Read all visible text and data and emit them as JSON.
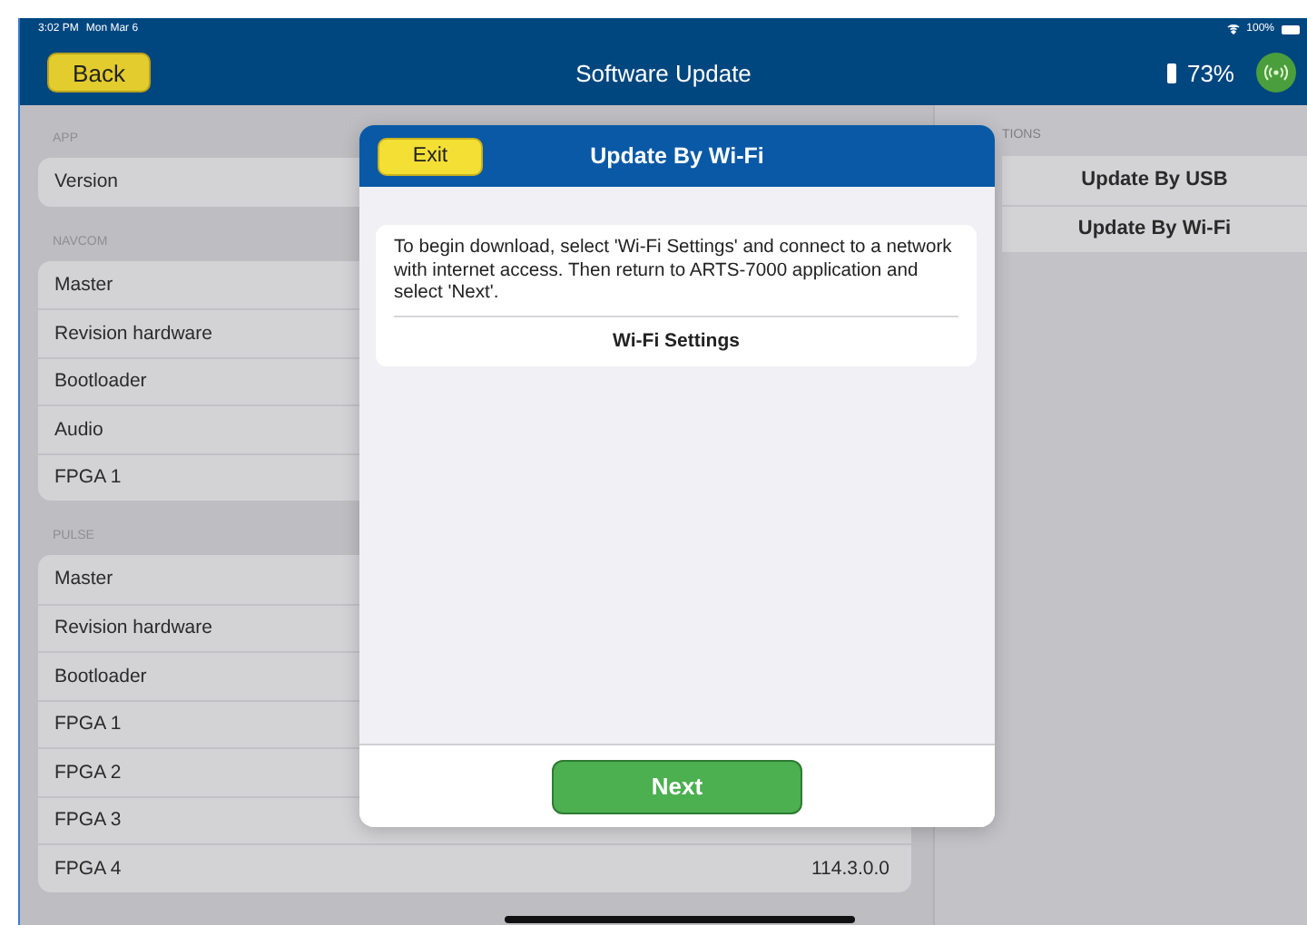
{
  "status_bar": {
    "time": "3:02 PM",
    "date": "Mon Mar 6",
    "battery": "100%"
  },
  "nav_bar": {
    "back": "Back",
    "title": "Software Update",
    "battery": "73%"
  },
  "sections": [
    {
      "header": "APP",
      "rows": [
        {
          "label": "Version"
        }
      ]
    },
    {
      "header": "NAVCOM",
      "rows": [
        {
          "label": "Master"
        },
        {
          "label": "Revision hardware"
        },
        {
          "label": "Bootloader"
        },
        {
          "label": "Audio"
        },
        {
          "label": "FPGA 1"
        }
      ]
    },
    {
      "header": "PULSE",
      "rows": [
        {
          "label": "Master"
        },
        {
          "label": "Revision hardware"
        },
        {
          "label": "Bootloader"
        },
        {
          "label": "FPGA 1"
        },
        {
          "label": "FPGA 2"
        },
        {
          "label": "FPGA 3"
        },
        {
          "label": "FPGA 4",
          "value": "114.3.0.0"
        }
      ]
    }
  ],
  "options": {
    "header": "TIONS",
    "buttons": [
      "Update By USB",
      "Update By Wi-Fi"
    ]
  },
  "dialog": {
    "exit": "Exit",
    "title": "Update By Wi-Fi",
    "message": "To begin download, select 'Wi-Fi Settings' and connect to a network with internet access. Then return to ARTS-7000 application and select 'Next'.",
    "link": "Wi-Fi Settings",
    "next": "Next"
  }
}
